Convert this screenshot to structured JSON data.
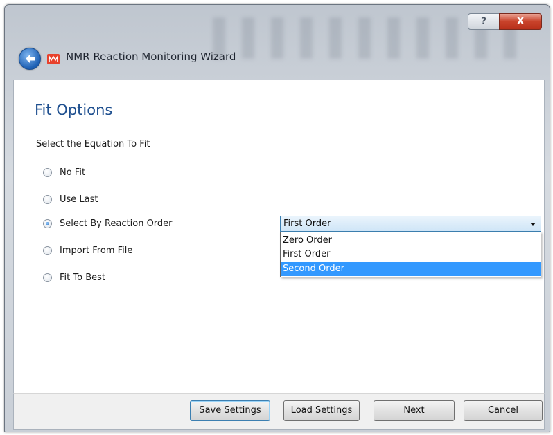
{
  "window": {
    "title": "NMR Reaction Monitoring Wizard",
    "help_glyph": "?",
    "close_glyph": "X"
  },
  "icons": {
    "back": "back-arrow-icon",
    "app": "mnova-app-icon"
  },
  "page": {
    "heading": "Fit Options",
    "subheading": "Select the Equation To Fit"
  },
  "fit_options": [
    {
      "label": "No Fit",
      "checked": false
    },
    {
      "label": "Use Last",
      "checked": false
    },
    {
      "label": "Select By Reaction Order",
      "checked": true
    },
    {
      "label": "Import From File",
      "checked": false
    },
    {
      "label": "Fit To Best",
      "checked": false
    }
  ],
  "reaction_order": {
    "selected": "First Order",
    "options": [
      "Zero Order",
      "First Order",
      "Second Order"
    ],
    "highlighted": "Second Order"
  },
  "buttons": {
    "save_settings_prefix": "S",
    "save_settings_rest": "ave Settings",
    "load_settings_prefix": "L",
    "load_settings_rest": "oad Settings",
    "next_prefix": "N",
    "next_rest": "ext",
    "cancel": "Cancel"
  },
  "colors": {
    "heading": "#1e4f8f",
    "selection": "#3399ff",
    "close_button": "#c9432b"
  }
}
